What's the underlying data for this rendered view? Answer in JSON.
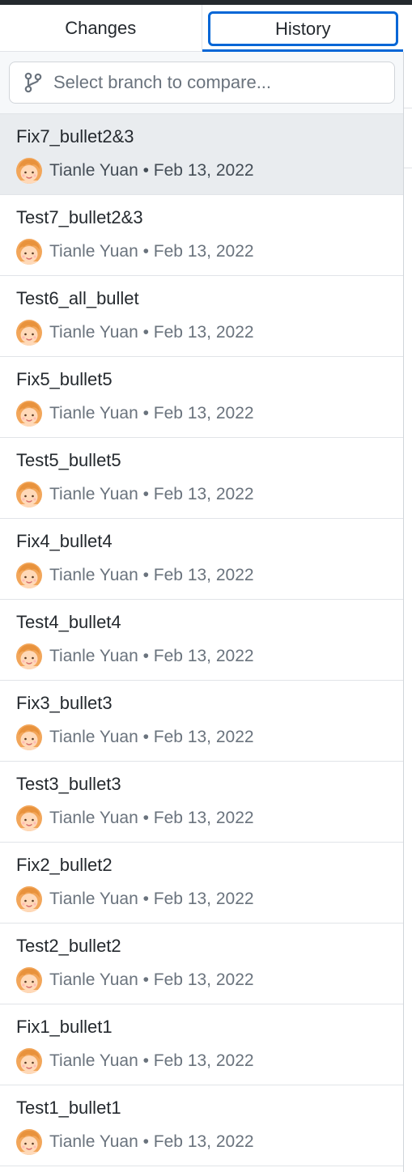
{
  "tabs": {
    "changes_label": "Changes",
    "history_label": "History",
    "active": "History"
  },
  "branch_compare": {
    "placeholder": "Select branch to compare...",
    "icon": "git-branch-icon"
  },
  "colors": {
    "accent": "#0366d6",
    "selected_row": "#e9ecef",
    "meta_text": "#6a737d"
  },
  "commits": [
    {
      "title": "Fix7_bullet2&3",
      "author": "Tianle Yuan",
      "date": "Feb 13, 2022",
      "selected": true
    },
    {
      "title": "Test7_bullet2&3",
      "author": "Tianle Yuan",
      "date": "Feb 13, 2022",
      "selected": false
    },
    {
      "title": "Test6_all_bullet",
      "author": "Tianle Yuan",
      "date": "Feb 13, 2022",
      "selected": false
    },
    {
      "title": "Fix5_bullet5",
      "author": "Tianle Yuan",
      "date": "Feb 13, 2022",
      "selected": false
    },
    {
      "title": "Test5_bullet5",
      "author": "Tianle Yuan",
      "date": "Feb 13, 2022",
      "selected": false
    },
    {
      "title": "Fix4_bullet4",
      "author": "Tianle Yuan",
      "date": "Feb 13, 2022",
      "selected": false
    },
    {
      "title": "Test4_bullet4",
      "author": "Tianle Yuan",
      "date": "Feb 13, 2022",
      "selected": false
    },
    {
      "title": "Fix3_bullet3",
      "author": "Tianle Yuan",
      "date": "Feb 13, 2022",
      "selected": false
    },
    {
      "title": "Test3_bullet3",
      "author": "Tianle Yuan",
      "date": "Feb 13, 2022",
      "selected": false
    },
    {
      "title": "Fix2_bullet2",
      "author": "Tianle Yuan",
      "date": "Feb 13, 2022",
      "selected": false
    },
    {
      "title": "Test2_bullet2",
      "author": "Tianle Yuan",
      "date": "Feb 13, 2022",
      "selected": false
    },
    {
      "title": "Fix1_bullet1",
      "author": "Tianle Yuan",
      "date": "Feb 13, 2022",
      "selected": false
    },
    {
      "title": "Test1_bullet1",
      "author": "Tianle Yuan",
      "date": "Feb 13, 2022",
      "selected": false
    }
  ]
}
